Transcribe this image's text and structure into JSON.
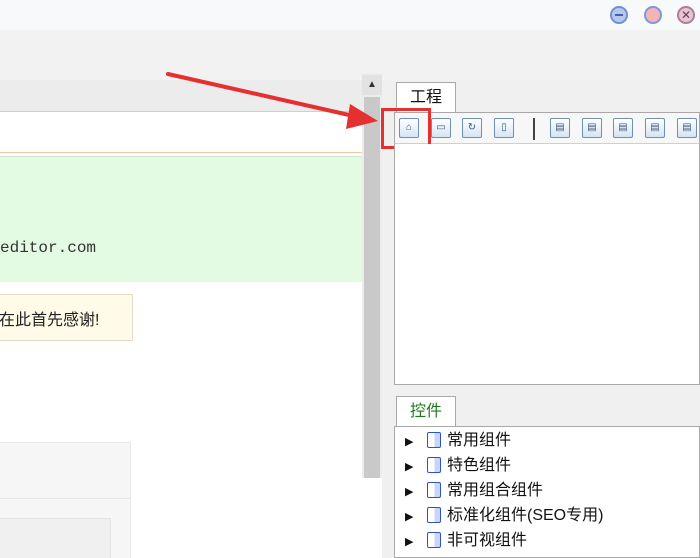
{
  "window": {
    "minimize_icon": "minimize-circle",
    "maximize_icon": "maximize-circle",
    "close_glyph": "✕"
  },
  "editor": {
    "site_text": "editor.com",
    "notice_text": "在此首先感谢!"
  },
  "project_panel": {
    "tab_label": "工程",
    "toolbar_icons": [
      "home-icon",
      "add-page-icon",
      "refresh-icon",
      "document-icon",
      "chart-add-icon",
      "chart-plus-icon",
      "chart-minus-icon",
      "chart-down-icon",
      "chart-up-icon"
    ]
  },
  "controls_panel": {
    "tab_label": "控件",
    "items": [
      {
        "label": "常用组件"
      },
      {
        "label": "特色组件"
      },
      {
        "label": "常用组合组件"
      },
      {
        "label": "标准化组件(SEO专用)"
      },
      {
        "label": "非可视组件"
      }
    ]
  },
  "colors": {
    "annotation_red": "#e53030",
    "controls_tab_green": "#1f7a1f",
    "green_box": "#e3fbe3",
    "notice_bg": "#fffbe8"
  }
}
